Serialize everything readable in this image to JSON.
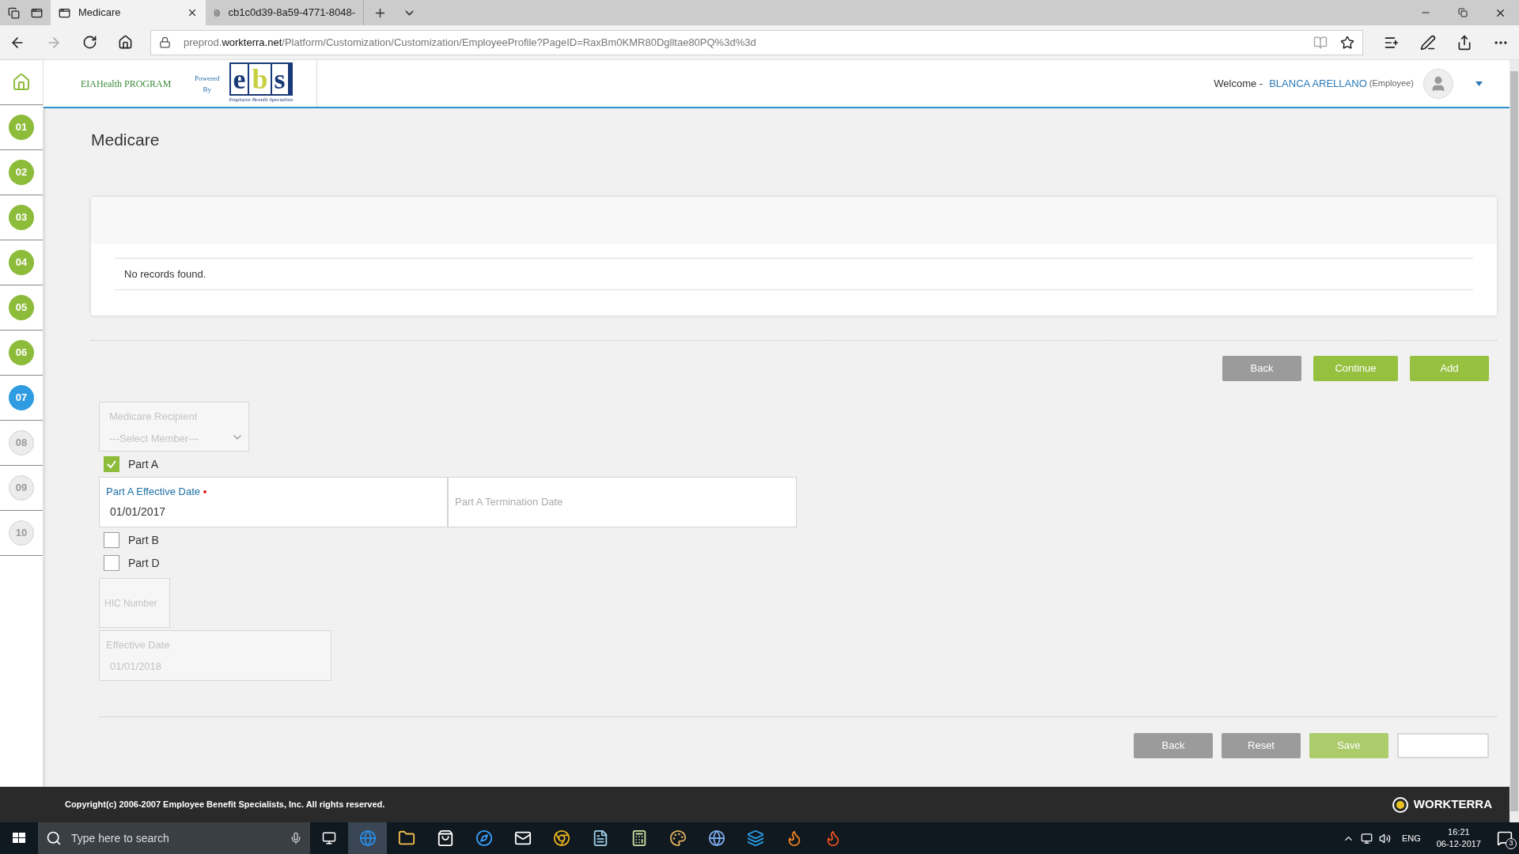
{
  "browser": {
    "tabs": [
      {
        "title": "Medicare",
        "kind": "page",
        "selected": true
      },
      {
        "title": "cb1c0d39-8a59-4771-8048-",
        "kind": "pdf",
        "selected": false
      }
    ],
    "url": {
      "prefix": "preprod.",
      "domain": "workterra.net",
      "path": "/Platform/Customization/Customization/EmployeeProfile?PageID=RaxBm0KMR80Dglltae80PQ%3d%3d"
    }
  },
  "header": {
    "program": "EIAHealth PROGRAM",
    "powered": "Powered",
    "by": "By",
    "logo_letters": [
      "e",
      "b",
      "s"
    ],
    "logo_tagline": "Employee Benefit Specialists",
    "welcome": "Welcome -",
    "user": "BLANCA ARELLANO",
    "role": "(Employee)"
  },
  "steps": [
    {
      "label": "01",
      "done": true,
      "current": false
    },
    {
      "label": "02",
      "done": true,
      "current": false
    },
    {
      "label": "03",
      "done": true,
      "current": false
    },
    {
      "label": "04",
      "done": true,
      "current": false
    },
    {
      "label": "05",
      "done": true,
      "current": false
    },
    {
      "label": "06",
      "done": true,
      "current": false
    },
    {
      "label": "07",
      "done": false,
      "current": true
    },
    {
      "label": "08",
      "done": false,
      "current": false
    },
    {
      "label": "09",
      "done": false,
      "current": false
    },
    {
      "label": "10",
      "done": false,
      "current": false
    }
  ],
  "page_title": "Medicare",
  "records": {
    "empty_message": "No records found."
  },
  "top_buttons": [
    {
      "label": "Back",
      "kind": "secondary",
      "disabled": false
    },
    {
      "label": "Continue",
      "kind": "primary",
      "disabled": false
    },
    {
      "label": "Add",
      "kind": "primary",
      "disabled": false
    }
  ],
  "form": [
    {
      "kind": "select",
      "label": "Medicare Recipient",
      "placeholder": "---Select Member---",
      "disabled": true
    },
    {
      "kind": "checkbox",
      "label": "Part A",
      "checked": true
    },
    {
      "kind": "date_pair",
      "fields": [
        {
          "label": "Part A Effective Date",
          "required": true,
          "value": "01/01/2017"
        },
        {
          "label": "Part A Termination Date",
          "required": false
        }
      ]
    },
    {
      "kind": "checkbox",
      "label": "Part B",
      "checked": false
    },
    {
      "kind": "checkbox",
      "label": "Part D",
      "checked": false
    },
    {
      "kind": "text",
      "label": "HIC Number",
      "disabled": true
    },
    {
      "kind": "date",
      "label": "Effective Date",
      "value": "01/01/2018",
      "disabled": true
    }
  ],
  "bottom_buttons": [
    {
      "label": "Back",
      "kind": "secondary",
      "disabled": false
    },
    {
      "label": "Reset",
      "kind": "secondary",
      "disabled": false
    },
    {
      "label": "Save",
      "kind": "primary",
      "disabled": true
    },
    {
      "kind": "blank"
    }
  ],
  "footer": {
    "copyright": "Copyright(c) 2006-2007 Employee Benefit Specialists, Inc. All rights reserved.",
    "brand": "WORKTERRA"
  },
  "taskbar": {
    "search_placeholder": "Type here to search",
    "language": "ENG",
    "time": "16:21",
    "date": "06-12-2017",
    "notifications": "3"
  }
}
